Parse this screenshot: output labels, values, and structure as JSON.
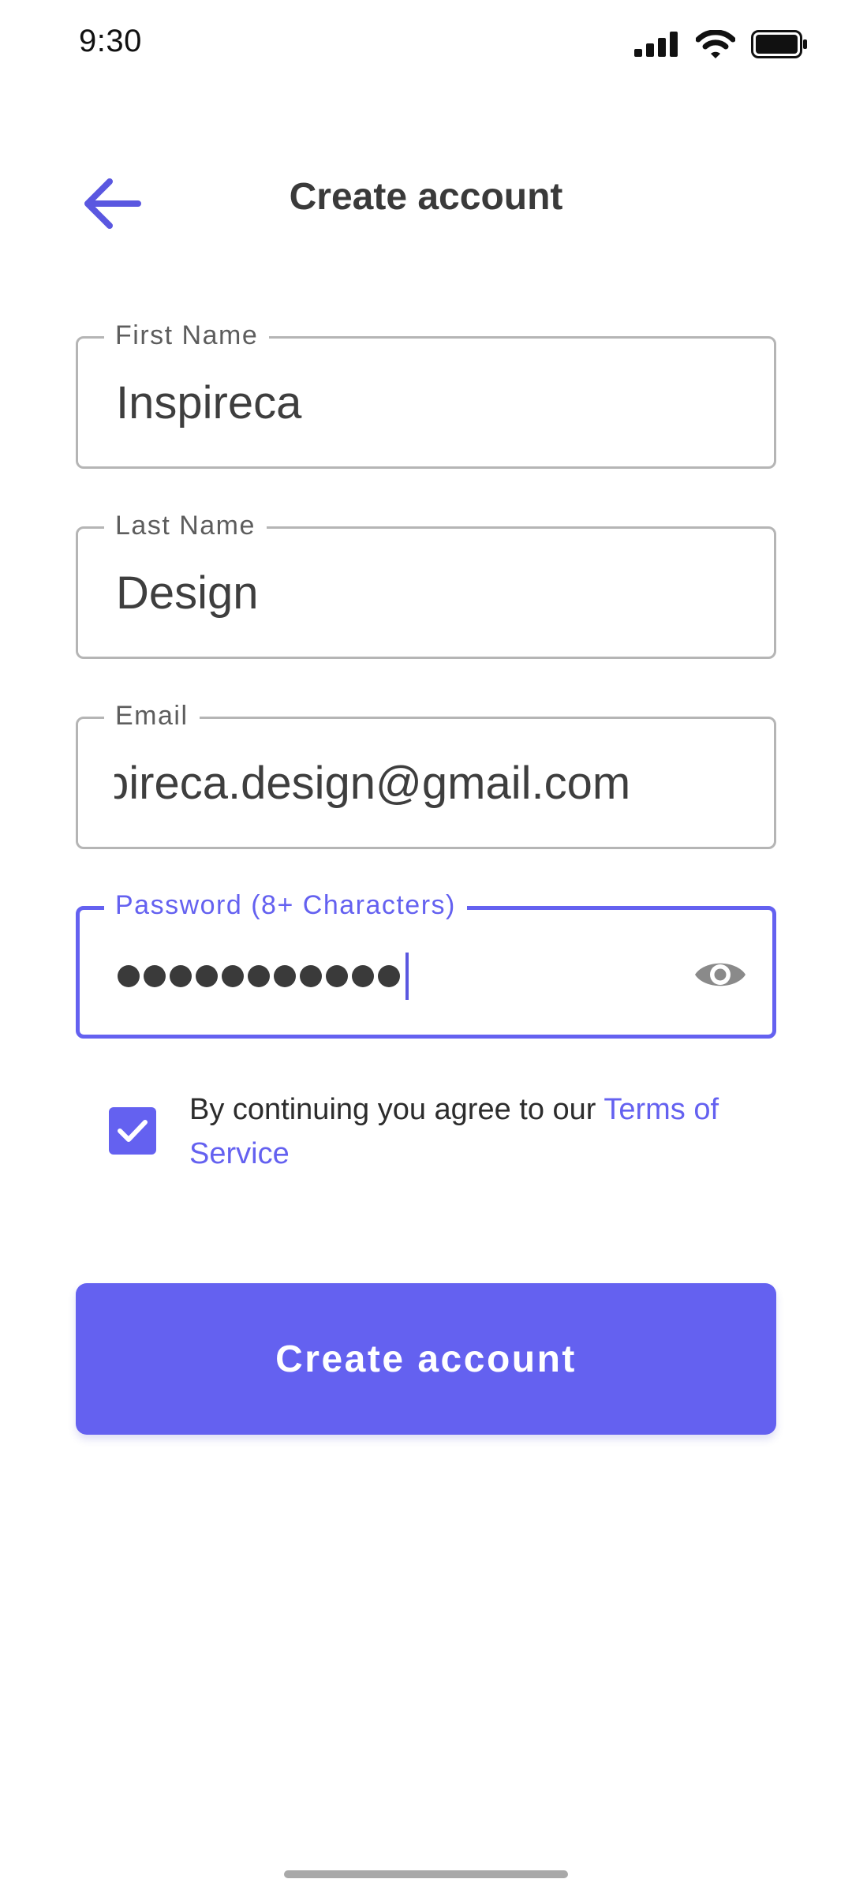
{
  "status_bar": {
    "time": "9:30",
    "icons": [
      "cellular-signal-icon",
      "wifi-icon",
      "battery-icon"
    ]
  },
  "header": {
    "back_icon": "arrow-left-icon",
    "title": "Create account"
  },
  "form": {
    "first_name": {
      "label": "First Name",
      "value": "Inspireca"
    },
    "last_name": {
      "label": "Last Name",
      "value": "Design"
    },
    "email": {
      "label": "Email",
      "value": "pireca.design@gmail.com"
    },
    "password": {
      "label": "Password (8+ Characters)",
      "masked_length": 11,
      "toggle_icon": "eye-icon",
      "focused": true
    }
  },
  "terms": {
    "checked": true,
    "text": "By continuing you agree to our ",
    "link_text": "Terms of Service"
  },
  "primary_action": {
    "label": "Create account"
  },
  "colors": {
    "accent": "#6461f0",
    "text_primary": "#3e3e3e",
    "border": "#b5b5b5",
    "label": "#5d5d5d"
  }
}
